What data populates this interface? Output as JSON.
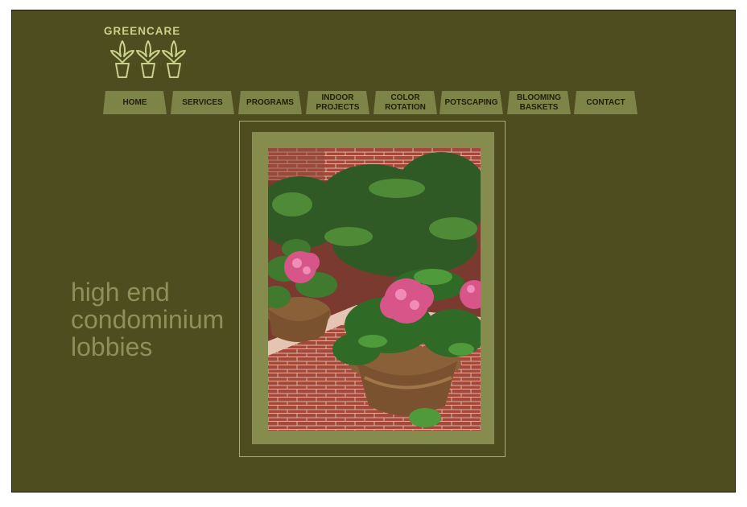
{
  "brand": {
    "name": "GREENCARE",
    "logo_icon": "potted-plant-icon"
  },
  "nav": {
    "items": [
      {
        "line1": "HOME",
        "line2": ""
      },
      {
        "line1": "SERVICES",
        "line2": ""
      },
      {
        "line1": "PROGRAMS",
        "line2": ""
      },
      {
        "line1": "INDOOR",
        "line2": "PROJECTS"
      },
      {
        "line1": "COLOR",
        "line2": "ROTATION"
      },
      {
        "line1": "POTSCAPING",
        "line2": ""
      },
      {
        "line1": "BLOOMING",
        "line2": "BASKETS"
      },
      {
        "line1": "CONTACT",
        "line2": ""
      }
    ]
  },
  "tagline": {
    "line1": "high end",
    "line2": "condominium",
    "line3": "lobbies"
  },
  "colors": {
    "background": "#4d4d1f",
    "tab": "#7d8448",
    "logo": "#c9d18a",
    "tagline": "#8f8f5a"
  }
}
